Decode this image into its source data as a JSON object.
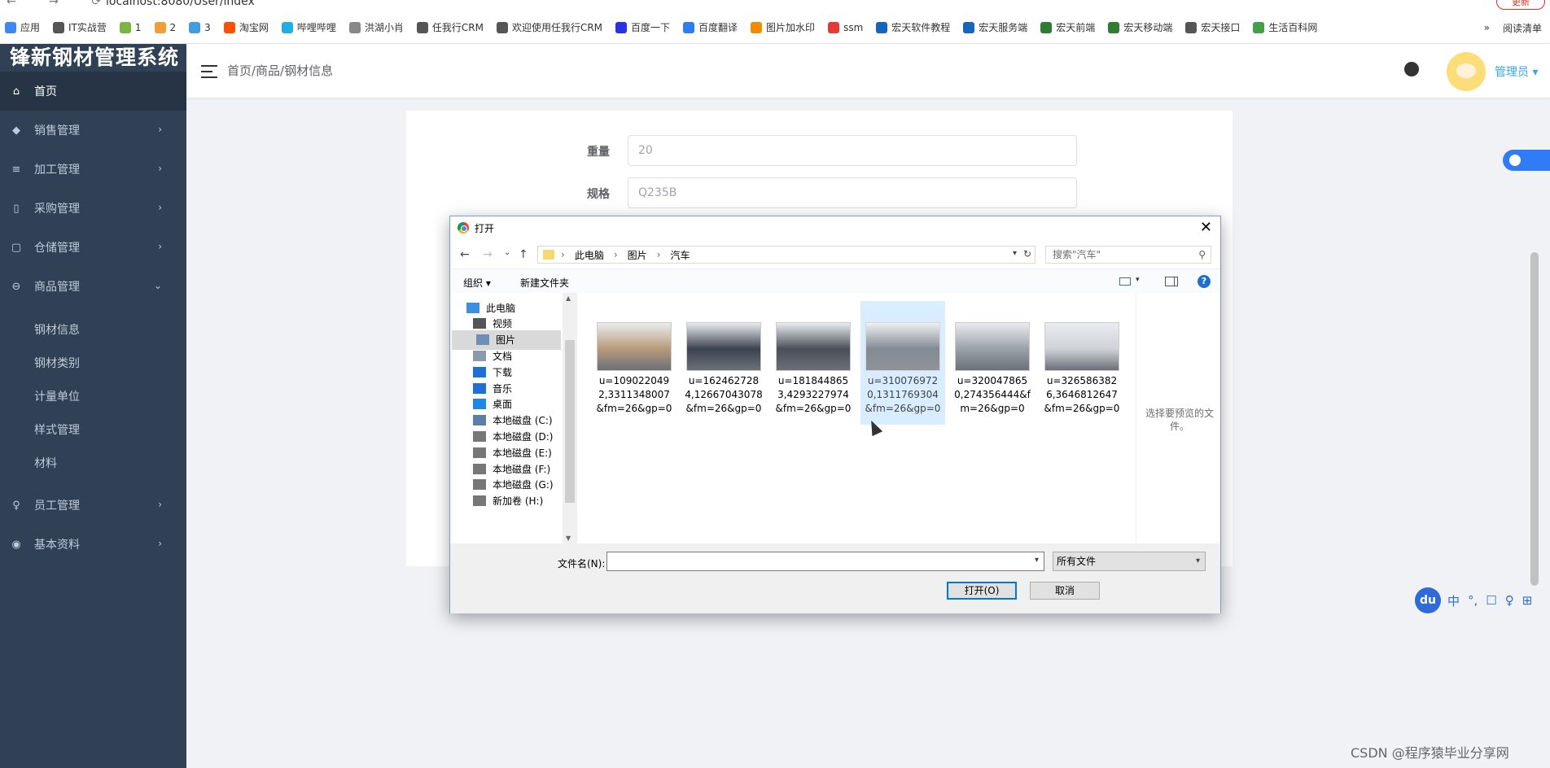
{
  "browser": {
    "url": "localhost:8080/User/index",
    "nav_glyphs": "← → ⟳",
    "update_label": "更新",
    "bookmarks": [
      {
        "label": "应用",
        "color": "#4285f4"
      },
      {
        "label": "IT实战营",
        "color": "#555555"
      },
      {
        "label": "1",
        "color": "#7cb342"
      },
      {
        "label": "2",
        "color": "#f29d38"
      },
      {
        "label": "3",
        "color": "#3f9de0"
      },
      {
        "label": "淘宝网",
        "color": "#ff5000"
      },
      {
        "label": "哔哩哔哩",
        "color": "#23ade5"
      },
      {
        "label": "洪湖小肖",
        "color": "#888888"
      },
      {
        "label": "任我行CRM",
        "color": "#555555"
      },
      {
        "label": "欢迎使用任我行CRM",
        "color": "#555555"
      },
      {
        "label": "百度一下",
        "color": "#2932e1"
      },
      {
        "label": "百度翻译",
        "color": "#2f7cf6"
      },
      {
        "label": "图片加水印",
        "color": "#f08c00"
      },
      {
        "label": "ssm",
        "color": "#e53935"
      },
      {
        "label": "宏天软件教程",
        "color": "#1565c0"
      },
      {
        "label": "宏天服务端",
        "color": "#1565c0"
      },
      {
        "label": "宏天前端",
        "color": "#2e7d32"
      },
      {
        "label": "宏天移动端",
        "color": "#2e7d32"
      },
      {
        "label": "宏天接口",
        "color": "#555555"
      },
      {
        "label": "生活百科网",
        "color": "#43a047"
      }
    ],
    "more_label": "»",
    "reading_list": "阅读清单"
  },
  "sidebar": {
    "title": "锋新钢材管理系统",
    "items": [
      {
        "label": "首页",
        "icon": "home-icon",
        "glyph": "⌂",
        "active": true
      },
      {
        "label": "销售管理",
        "icon": "tag-icon",
        "glyph": "◆",
        "arrow": "›"
      },
      {
        "label": "加工管理",
        "icon": "list-icon",
        "glyph": "≡",
        "arrow": "›"
      },
      {
        "label": "采购管理",
        "icon": "document-icon",
        "glyph": "▯",
        "arrow": "›"
      },
      {
        "label": "仓储管理",
        "icon": "briefcase-icon",
        "glyph": "▢",
        "arrow": "›"
      },
      {
        "label": "商品管理",
        "icon": "circle-icon",
        "glyph": "⊖",
        "arrow": "⌄"
      }
    ],
    "sub_items": [
      "钢材信息",
      "钢材类别",
      "计量单位",
      "样式管理",
      "材料"
    ],
    "bottom_items": [
      {
        "label": "员工管理",
        "icon": "user-icon",
        "glyph": "♀",
        "arrow": "›"
      },
      {
        "label": "基本资料",
        "icon": "palette-icon",
        "glyph": "◉",
        "arrow": "›"
      }
    ]
  },
  "header": {
    "breadcrumb": "首页/商品/钢材信息",
    "user": "管理员 ▾"
  },
  "form": {
    "fields": [
      {
        "label": "重量",
        "value": "20"
      },
      {
        "label": "规格",
        "value": "Q235B"
      }
    ]
  },
  "dialog": {
    "title": "打开",
    "close": "✕",
    "nav": {
      "back": "←",
      "forward": "→",
      "recent": "⌄",
      "up": "↑"
    },
    "path": [
      "此电脑",
      "图片",
      "汽车"
    ],
    "refresh": "↻",
    "search_placeholder": "搜索\"汽车\"",
    "toolbar": {
      "organize": "组织 ▾",
      "new_folder": "新建文件夹",
      "help": "?"
    },
    "tree": [
      {
        "label": "此电脑",
        "color": "#3a8ee6"
      },
      {
        "label": "视频",
        "color": "#555555"
      },
      {
        "label": "图片",
        "color": "#6f8fb5",
        "selected": true
      },
      {
        "label": "文档",
        "color": "#8a9bb0"
      },
      {
        "label": "下载",
        "color": "#1e6fd6"
      },
      {
        "label": "音乐",
        "color": "#1e6fd6"
      },
      {
        "label": "桌面",
        "color": "#1e88e5"
      },
      {
        "label": "本地磁盘 (C:)",
        "color": "#5b7fa8"
      },
      {
        "label": "本地磁盘 (D:)",
        "color": "#777777"
      },
      {
        "label": "本地磁盘 (E:)",
        "color": "#777777"
      },
      {
        "label": "本地磁盘 (F:)",
        "color": "#777777"
      },
      {
        "label": "本地磁盘 (G:)",
        "color": "#777777"
      },
      {
        "label": "新加卷 (H:)",
        "color": "#777777"
      }
    ],
    "files": [
      {
        "name": "u=1090220492,3311348007&fm=26&gp=0",
        "thumb": "#b89a7a"
      },
      {
        "name": "u=1624627284,12667043078&fm=26&gp=0",
        "thumb": "#3c4350"
      },
      {
        "name": "u=1818448653,4293227974&fm=26&gp=0",
        "thumb": "#4a4f57"
      },
      {
        "name": "u=3100769720,1311769304&fm=26&gp=0",
        "thumb": "#5a6470",
        "selected": true
      },
      {
        "name": "u=3200478650,274356444&fm=26&gp=0",
        "thumb": "#9aa1a8"
      },
      {
        "name": "u=3265863826,3646812647&fm=26&gp=0",
        "thumb": "#cfd3d8"
      }
    ],
    "preview_text": "选择要预览的文件。",
    "filename_label": "文件名(N):",
    "filename_value": "",
    "filetype": "所有文件",
    "open_button": "打开(O)",
    "cancel_button": "取消"
  },
  "ime": {
    "du": "du",
    "items": [
      "中",
      "°,",
      "☐",
      "♀",
      "⊞"
    ]
  },
  "watermark": "CSDN @程序猿毕业分享网"
}
